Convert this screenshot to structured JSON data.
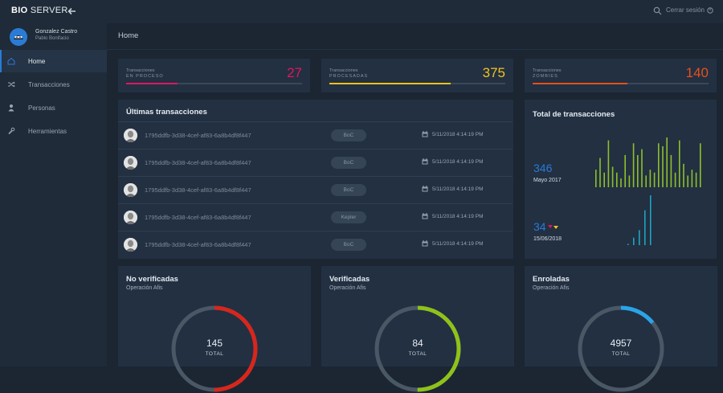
{
  "app": {
    "brand_bold": "BIO",
    "brand_rest": " SERVER",
    "logout_label": "Cerrar sesión"
  },
  "user": {
    "name": "Gonzalez Castro",
    "subtitle": "Pablo Bonifacio"
  },
  "sidebar": {
    "items": [
      {
        "label": "Home",
        "icon": "home-icon",
        "active": true
      },
      {
        "label": "Transacciones",
        "icon": "shuffle-icon",
        "active": false
      },
      {
        "label": "Personas",
        "icon": "person-icon",
        "active": false
      },
      {
        "label": "Herramientas",
        "icon": "wrench-icon",
        "active": false
      }
    ]
  },
  "page": {
    "title": "Home"
  },
  "stats": [
    {
      "label": "Transacciones",
      "sublabel": "en proceso",
      "value": "27",
      "progress": 0.29,
      "color": "#e0165f"
    },
    {
      "label": "Transacciones",
      "sublabel": "procesadas",
      "value": "375",
      "progress": 0.69,
      "color": "#f2c21c"
    },
    {
      "label": "Transacciones",
      "sublabel": "zombies",
      "value": "140",
      "progress": 0.54,
      "color": "#e8501a"
    }
  ],
  "transactions": {
    "title": "Últimas transacciones",
    "rows": [
      {
        "id": "1795ddfb-3d38-4cef-af83-6a8b4df8f447",
        "badge": "BoC",
        "date": "5/11/2018 4:14:19 PM"
      },
      {
        "id": "1795ddfb-3d38-4cef-af83-6a8b4df8f447",
        "badge": "BoC",
        "date": "5/11/2018 4:14:19 PM"
      },
      {
        "id": "1795ddfb-3d38-4cef-af83-6a8b4df8f447",
        "badge": "BoC",
        "date": "5/11/2018 4:14:19 PM"
      },
      {
        "id": "1795ddfb-3d38-4cef-af83-6a8b4df8f447",
        "badge": "Kepler",
        "date": "5/11/2018 4:14:19 PM"
      },
      {
        "id": "1795ddfb-3d38-4cef-af83-6a8b4df8f447",
        "badge": "BoC",
        "date": "5/11/2018 4:14:19 PM"
      }
    ]
  },
  "totals": {
    "title": "Total de transacciones",
    "month_value": "346",
    "month_label": "Mayo 2017",
    "day_value": "34",
    "day_label": "15/06/2018",
    "month_color": "#8fbf2a",
    "day_color": "#1fa3c0"
  },
  "chart_data": [
    {
      "type": "bar",
      "values": [
        12,
        20,
        10,
        32,
        14,
        10,
        6,
        22,
        8,
        30,
        22,
        26,
        8,
        12,
        10,
        30,
        28,
        34,
        22,
        10,
        32,
        16,
        8,
        12,
        10,
        30
      ]
    },
    {
      "type": "bar",
      "values": [
        1,
        6,
        12,
        28,
        40
      ]
    }
  ],
  "donuts": [
    {
      "title": "No verificadas",
      "subtitle": "Operación Afis",
      "value": "145",
      "caption": "TOTAL",
      "fraction": 0.5,
      "color": "#d8261c"
    },
    {
      "title": "Verificadas",
      "subtitle": "Operación Afis",
      "value": "84",
      "caption": "TOTAL",
      "fraction": 0.5,
      "color": "#8fc219"
    },
    {
      "title": "Enroladas",
      "subtitle": "Operación Afis",
      "value": "4957",
      "caption": "TOTAL",
      "fraction": 0.14,
      "color": "#2aa4e8"
    }
  ]
}
